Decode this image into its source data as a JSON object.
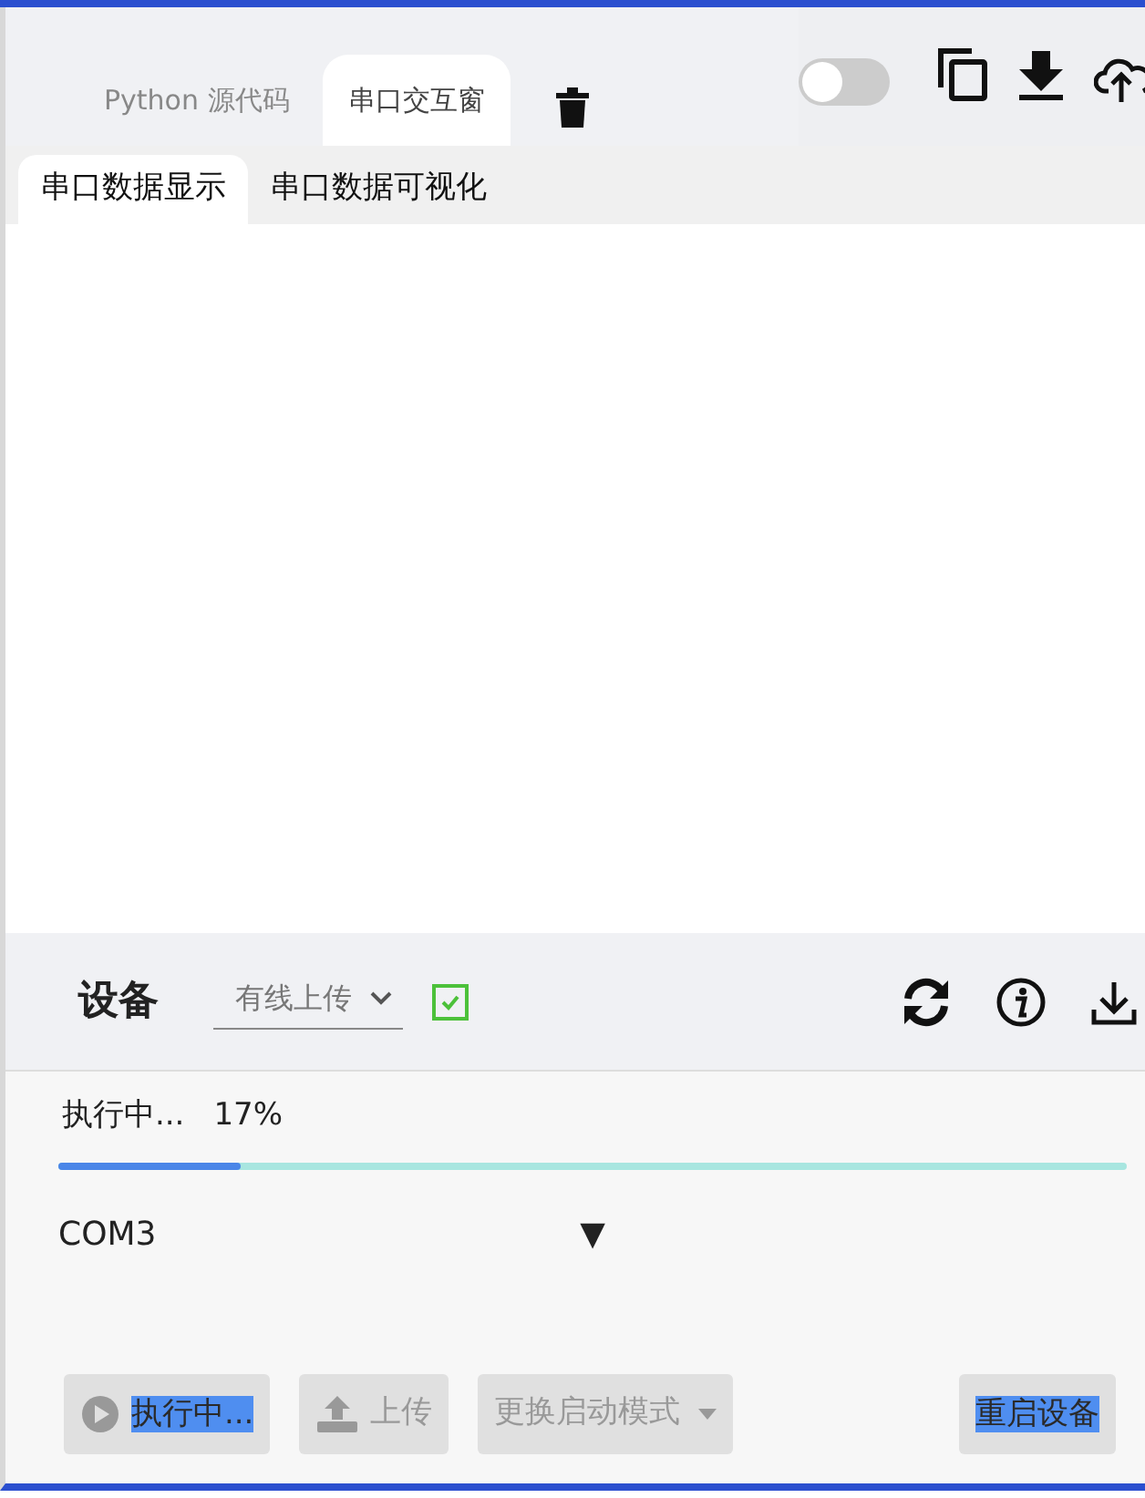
{
  "editor_tabs": [
    {
      "label": "Python 源代码",
      "selected": false
    },
    {
      "label": "串口交互窗",
      "selected": true
    }
  ],
  "toggle": {
    "on": false
  },
  "view_tabs": [
    {
      "label": "串口数据显示",
      "selected": true
    },
    {
      "label": "串口数据可视化",
      "selected": false
    }
  ],
  "device_panel": {
    "title": "设备",
    "upload_mode": {
      "value": "有线上传"
    },
    "auto_checkbox": {
      "checked": true
    }
  },
  "progress": {
    "status": "执行中...",
    "percent": "17%",
    "level": 0.17
  },
  "port_select": {
    "value": "COM3",
    "arrow": "▼"
  },
  "buttons": [
    {
      "kind": "run",
      "label": "执行中...",
      "disabled": true,
      "text_selected": true
    },
    {
      "kind": "upload",
      "label": "上传",
      "disabled": true,
      "text_selected": false
    },
    {
      "kind": "dropdown",
      "label": "更换启动模式",
      "disabled": true,
      "text_selected": false
    },
    {
      "kind": "restart",
      "label": "重启设备",
      "disabled": true,
      "text_selected": true
    }
  ]
}
